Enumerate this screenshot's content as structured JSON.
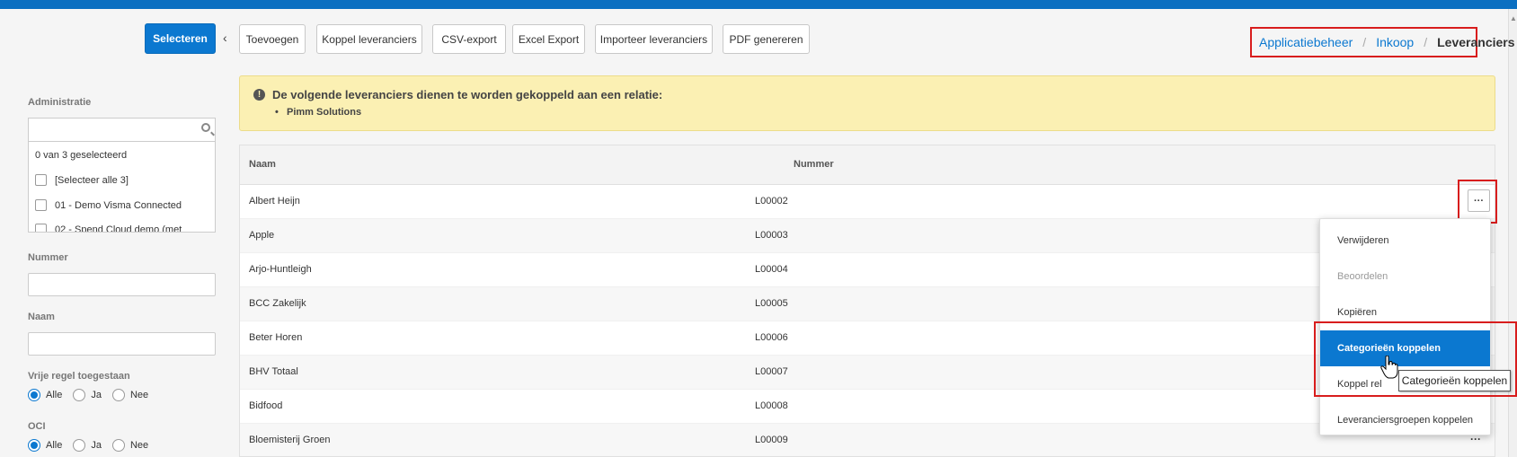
{
  "toolbar": {
    "select_label": "Selecteren",
    "buttons": [
      "Toevoegen",
      "Koppel leveranciers",
      "CSV-export",
      "Excel Export",
      "Importeer leveranciers",
      "PDF genereren"
    ]
  },
  "breadcrumb": {
    "items": [
      "Applicatiebeheer",
      "Inkoop"
    ],
    "separator": "/",
    "current": "Leveranciers"
  },
  "sidebar": {
    "administratie": {
      "label": "Administratie",
      "search_value": "",
      "count_text": "0 van 3 geselecteerd",
      "options": [
        "[Selecteer alle 3]",
        "01 - Demo Visma Connected",
        "02 - Spend Cloud demo (met"
      ]
    },
    "nummer_label": "Nummer",
    "nummer_value": "",
    "naam_label": "Naam",
    "naam_value": "",
    "vrije_regel": {
      "label": "Vrije regel toegestaan",
      "options": [
        "Alle",
        "Ja",
        "Nee"
      ],
      "selected": "Alle"
    },
    "oci": {
      "label": "OCI",
      "options": [
        "Alle",
        "Ja",
        "Nee"
      ],
      "selected": "Alle"
    }
  },
  "alert": {
    "icon": "exclamation-circle-icon",
    "title": "De volgende leveranciers dienen te worden gekoppeld aan een relatie:",
    "items": [
      "Pimm Solutions"
    ]
  },
  "table": {
    "headers": [
      "Naam",
      "Nummer"
    ],
    "rows": [
      [
        "Albert Heijn",
        "L00002"
      ],
      [
        "Apple",
        "L00003"
      ],
      [
        "Arjo-Huntleigh",
        "L00004"
      ],
      [
        "BCC Zakelijk",
        "L00005"
      ],
      [
        "Beter Horen",
        "L00006"
      ],
      [
        "BHV Totaal",
        "L00007"
      ],
      [
        "Bidfood",
        "L00008"
      ],
      [
        "Bloemisterij Groen",
        "L00009"
      ]
    ],
    "more_label": "···"
  },
  "menu": {
    "items": [
      "Verwijderen",
      "Beoordelen",
      "Kopiëren",
      "Categorieën koppelen",
      "Koppel rel",
      "Leveranciersgroepen koppelen"
    ],
    "disabled": "Beoordelen",
    "active": "Categorieën koppelen"
  },
  "tooltip": "Categorieën koppelen",
  "colors": {
    "primary": "#0b78d0",
    "highlight": "#d81d1d",
    "alert_bg": "#fbf0b3"
  }
}
